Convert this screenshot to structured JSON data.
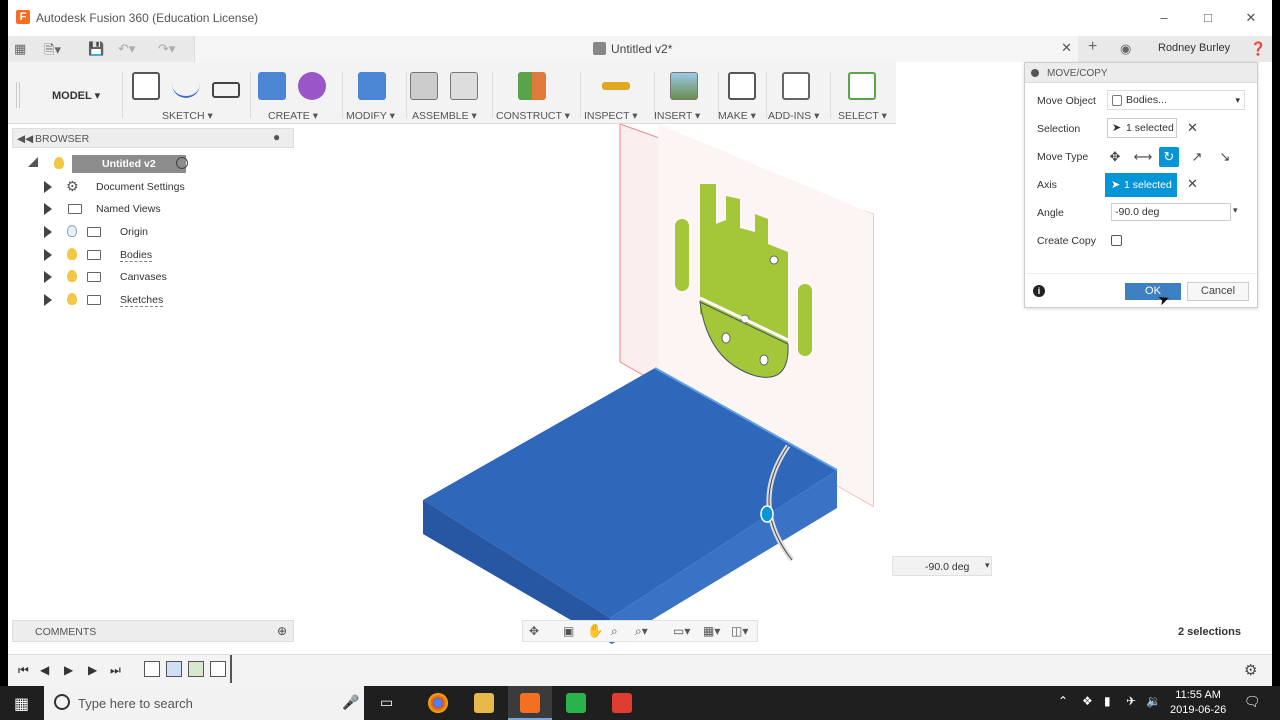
{
  "window": {
    "title": "Autodesk Fusion 360 (Education License)",
    "logo_letter": "F"
  },
  "tab": {
    "document_name": "Untitled v2*",
    "user_name": "Rodney Burley"
  },
  "toolbar": {
    "workspace": "MODEL",
    "groups": [
      "SKETCH",
      "CREATE",
      "MODIFY",
      "ASSEMBLE",
      "CONSTRUCT",
      "INSPECT",
      "INSERT",
      "MAKE",
      "ADD-INS",
      "SELECT"
    ]
  },
  "browser": {
    "header": "BROWSER",
    "root": "Untitled v2",
    "items": [
      "Document Settings",
      "Named Views",
      "Origin",
      "Bodies",
      "Canvases",
      "Sketches"
    ]
  },
  "dialog": {
    "title": "MOVE/COPY",
    "move_object_label": "Move Object",
    "move_object_value": "Bodies...",
    "selection_label": "Selection",
    "selection_value": "1 selected",
    "move_type_label": "Move Type",
    "axis_label": "Axis",
    "axis_value": "1 selected",
    "angle_label": "Angle",
    "angle_value": "-90.0 deg",
    "create_copy_label": "Create Copy",
    "create_copy_checked": false,
    "ok_label": "OK",
    "cancel_label": "Cancel"
  },
  "viewport": {
    "angle_input": "-90.0 deg"
  },
  "comments": {
    "header": "COMMENTS"
  },
  "status": {
    "selections": "2 selections"
  },
  "taskbar": {
    "search_placeholder": "Type here to search",
    "time": "11:55 AM",
    "date": "2019-06-26"
  },
  "colors": {
    "accent": "#0696d7",
    "ok_button": "#3e7fc1",
    "body_blue": "#2b63b5",
    "android_green": "#a4c639",
    "fusion_orange": "#f37021"
  }
}
